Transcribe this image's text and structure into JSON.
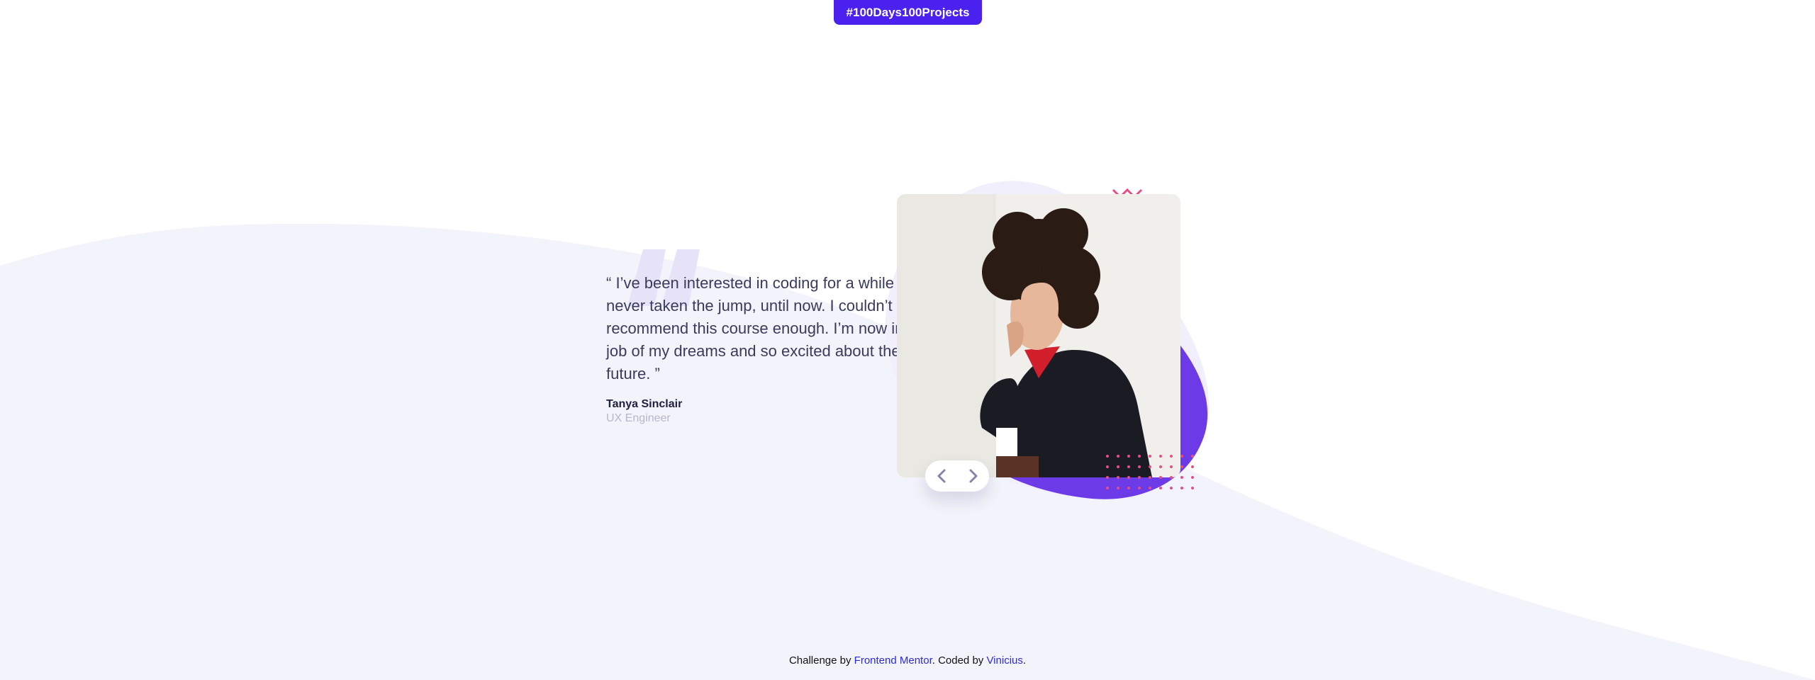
{
  "header": {
    "badge_label": "#100Days100Projects"
  },
  "testimonial": {
    "quote": "“ I’ve been interested in coding for a while but never taken the jump, until now. I couldn’t recommend this course enough. I’m now in the job of my dreams and so excited about the future. ”",
    "author_name": "Tanya Sinclair",
    "author_role": "UX Engineer"
  },
  "photo": {
    "alt": "Portrait of Tanya Sinclair"
  },
  "navigation": {
    "prev_icon": "chevron-left-icon",
    "next_icon": "chevron-right-icon"
  },
  "footer": {
    "prefix": "Challenge by ",
    "challenge_link": "Frontend Mentor",
    "middle": ". Coded by ",
    "author_link": "Vinicius",
    "suffix": "."
  },
  "colors": {
    "accent": "#4a21ef",
    "background_curve": "#f3f3fb",
    "blob_purple": "#6d3ae8",
    "text_dark": "#3a3b5c",
    "muted": "#b6b6cc",
    "link": "#2b2bd6"
  }
}
